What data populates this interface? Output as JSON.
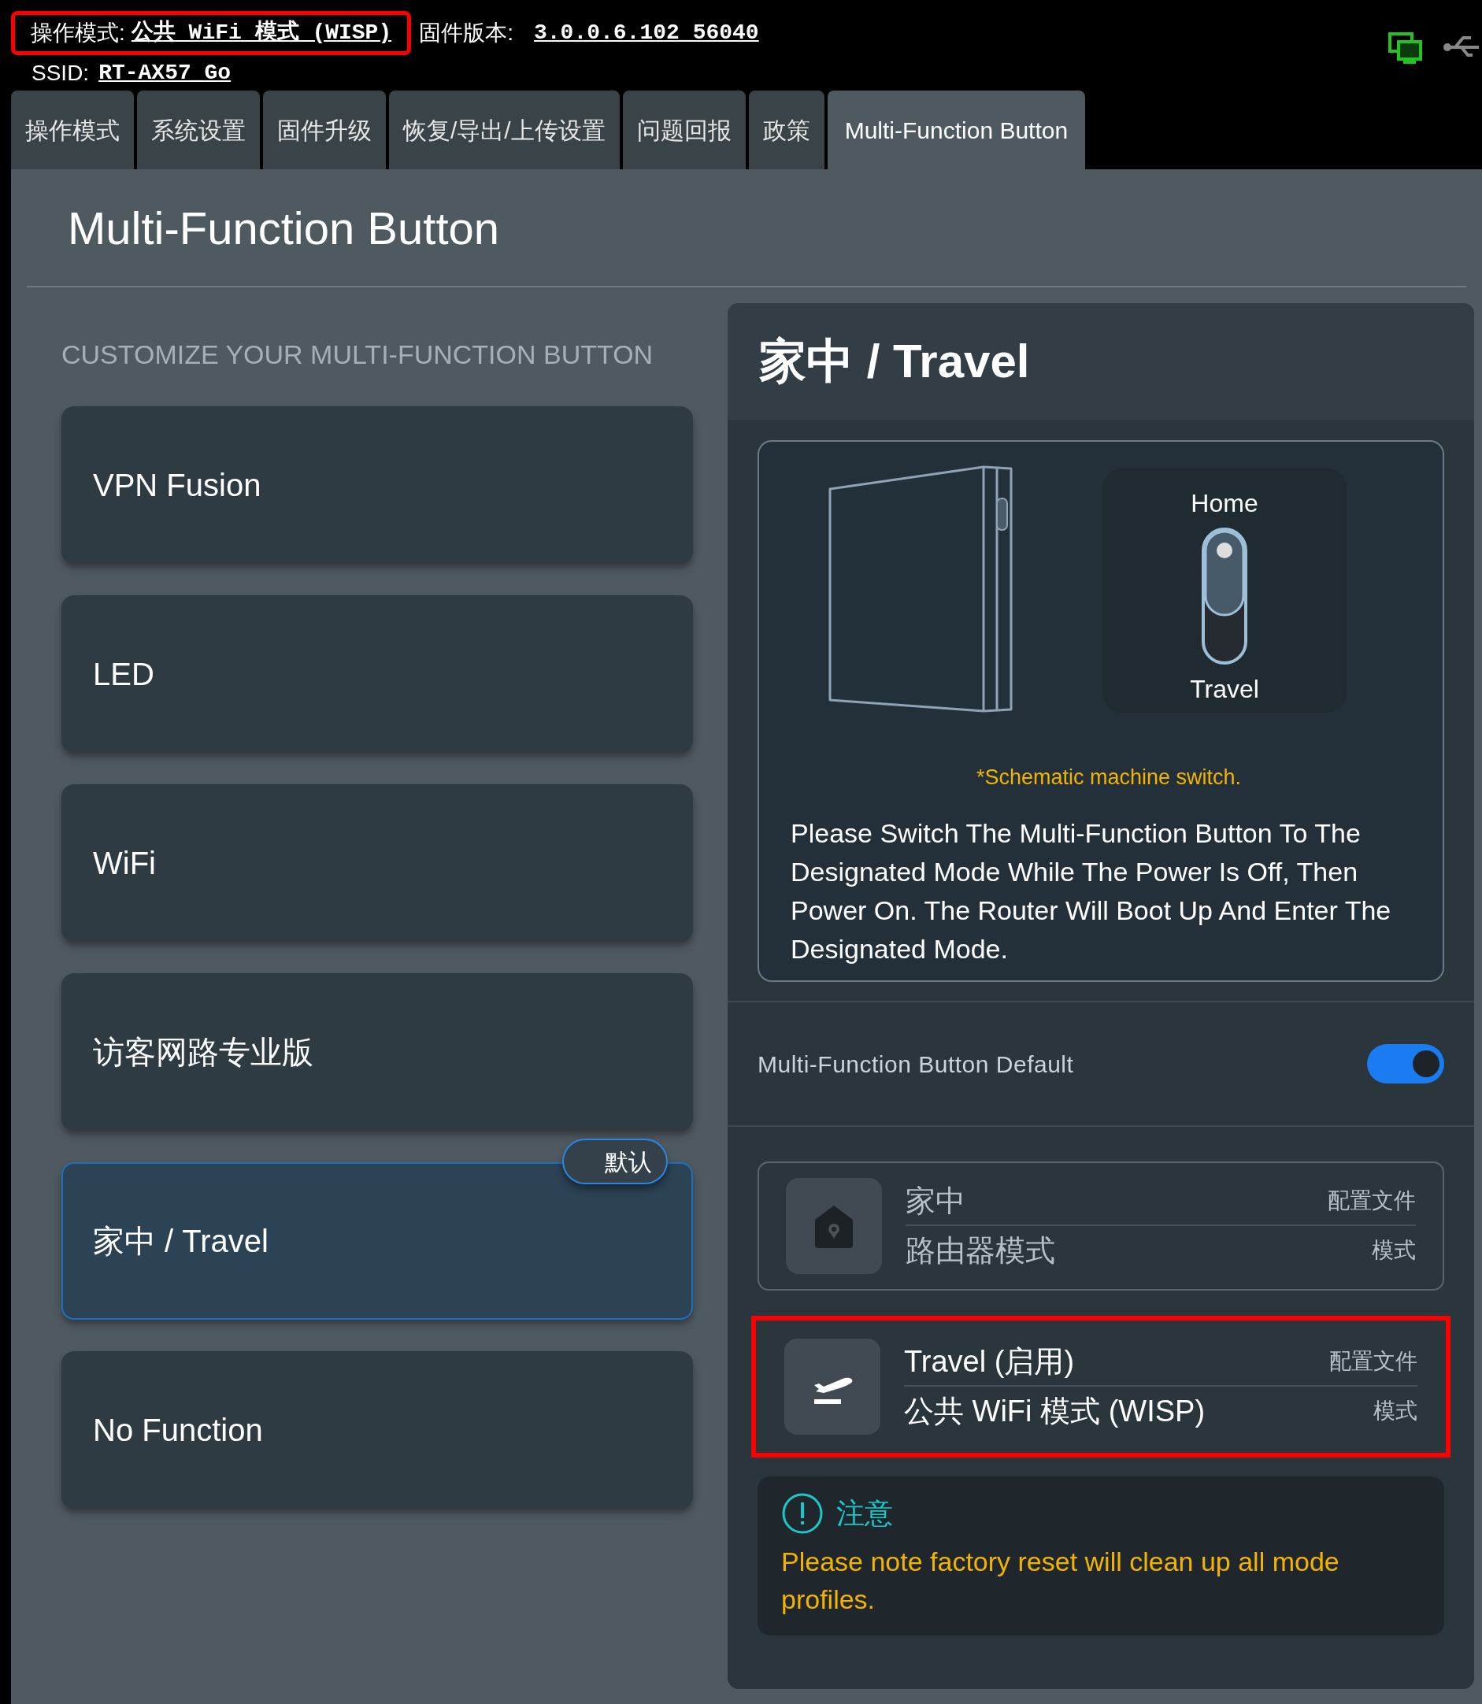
{
  "header": {
    "mode_label": "操作模式:",
    "mode_value": "公共 WiFi 模式 (WISP)",
    "mode_highlighted": true,
    "firmware_label": "固件版本:",
    "firmware_value": "3.0.0.6.102_56040",
    "ssid_label": "SSID:",
    "ssid_value": "RT-AX57_Go"
  },
  "tabs": [
    {
      "label": "操作模式",
      "selected": false
    },
    {
      "label": "系统设置",
      "selected": false
    },
    {
      "label": "固件升级",
      "selected": false
    },
    {
      "label": "恢复/导出/上传设置",
      "selected": false
    },
    {
      "label": "问题回报",
      "selected": false
    },
    {
      "label": "政策",
      "selected": false
    },
    {
      "label": "Multi-Function Button",
      "selected": true
    }
  ],
  "page_title": "Multi-Function Button",
  "functions_heading": "CUSTOMIZE YOUR MULTI-FUNCTION BUTTON",
  "functions": [
    {
      "label": "VPN Fusion",
      "selected": false
    },
    {
      "label": "LED",
      "selected": false
    },
    {
      "label": "WiFi",
      "selected": false
    },
    {
      "label": "访客网路专业版",
      "selected": false
    },
    {
      "label": "家中 / Travel",
      "selected": true,
      "badge": "默认"
    },
    {
      "label": "No Function",
      "selected": false
    }
  ],
  "detail": {
    "title": "家中 / Travel",
    "illustration": {
      "top_label": "Home",
      "bottom_label": "Travel",
      "home_selected": true
    },
    "caption": "*Schematic machine switch.",
    "description": "Please Switch The Multi-Function Button To The Designated Mode While The Power Is Off, Then Power On. The Router Will Boot Up And Enter The Designated Mode.",
    "default_toggle": {
      "label": "Multi-Function Button Default",
      "on": true
    },
    "profiles": [
      {
        "kind": "home",
        "name": "家中",
        "name_tag": "配置文件",
        "mode": "路由器模式",
        "mode_tag": "模式",
        "active": false,
        "highlighted": false
      },
      {
        "kind": "travel",
        "name": "Travel (启用)",
        "name_tag": "配置文件",
        "mode": "公共 WiFi 模式 (WISP)",
        "mode_tag": "模式",
        "active": true,
        "highlighted": true
      }
    ],
    "notice": {
      "title": "注意",
      "text": "Please note factory reset will clean up all mode profiles."
    }
  }
}
